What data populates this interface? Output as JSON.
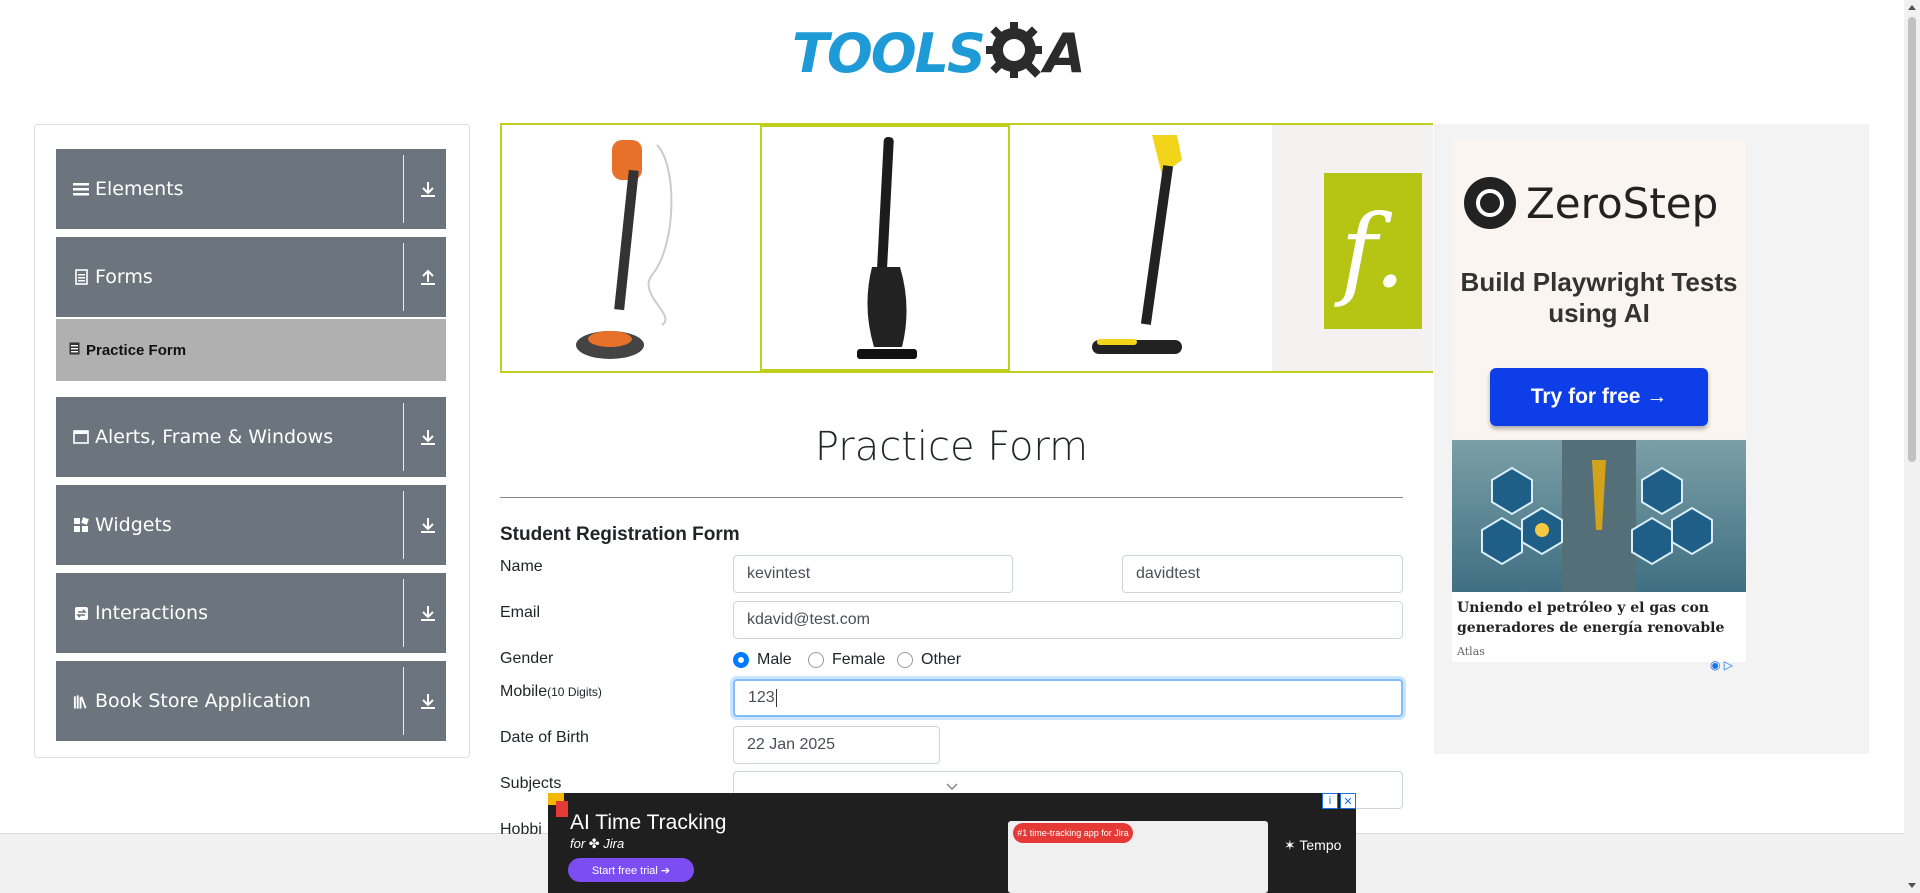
{
  "header": {
    "logo_text": "TOOLS",
    "logo_suffix": "A",
    "logo_q": "Q"
  },
  "sidebar": {
    "groups": [
      {
        "label": "Elements",
        "icon": "list-icon",
        "arrow": "download-icon"
      },
      {
        "label": "Forms",
        "icon": "form-icon",
        "arrow": "upload-icon"
      },
      {
        "label": "Alerts, Frame & Windows",
        "icon": "window-icon",
        "arrow": "download-icon"
      },
      {
        "label": "Widgets",
        "icon": "widgets-icon",
        "arrow": "download-icon"
      },
      {
        "label": "Interactions",
        "icon": "interaction-icon",
        "arrow": "download-icon"
      },
      {
        "label": "Book Store Application",
        "icon": "book-icon",
        "arrow": "download-icon"
      }
    ],
    "active_item": "Practice Form"
  },
  "banner": {
    "f_logo": "f."
  },
  "ad": {
    "brand": "ZeroStep",
    "tagline": "Build Playwright Tests using AI",
    "button": "Try for free →",
    "headline": "Uniendo el petróleo y el gas con generadores de energía renovable",
    "source": "Atlas"
  },
  "form": {
    "title": "Practice Form",
    "subtitle": "Student Registration Form",
    "name_label": "Name",
    "first_name": "kevintest",
    "last_name": "davidtest",
    "email_label": "Email",
    "email": "kdavid@test.com",
    "gender_label": "Gender",
    "genders": [
      "Male",
      "Female",
      "Other"
    ],
    "selected_gender": "Male",
    "mobile_label": "Mobile",
    "mobile_hint": "(10 Digits)",
    "mobile": "123",
    "dob_label": "Date of Birth",
    "dob": "22 Jan 2025",
    "subjects_label": "Subjects",
    "hobbies_label": "Hobbi"
  },
  "bottom_ad": {
    "title": "AI Time Tracking",
    "subtitle": "for ✤ Jira",
    "button": "Start free trial  ➔",
    "pill": "#1 time-tracking app for Jira",
    "brand": "✶ Tempo"
  },
  "colors": {
    "sidebar": "#6c757d",
    "active": "#b0b0b0",
    "accent": "#c0cf1e",
    "primary": "#007bff"
  }
}
